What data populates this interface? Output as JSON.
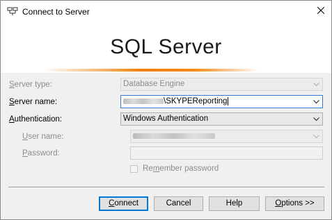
{
  "window": {
    "title": "Connect to Server",
    "icon": "server-connect-icon"
  },
  "banner": {
    "product": "SQL Server",
    "accent_color": "#f0800a"
  },
  "form": {
    "server_type": {
      "label": "Server type:",
      "value": "Database Engine",
      "enabled": false
    },
    "server_name": {
      "label": "Server name:",
      "value_suffix": "\\SKYPEReporting",
      "redacted_prefix": true,
      "focused": true
    },
    "authentication": {
      "label": "Authentication:",
      "value": "Windows Authentication"
    },
    "user_name": {
      "label": "User name:",
      "redacted": true,
      "enabled": false
    },
    "password": {
      "label": "Password:",
      "value": "",
      "enabled": false
    },
    "remember_password": {
      "label": "Remember password",
      "checked": false,
      "enabled": false
    }
  },
  "buttons": {
    "connect": "Connect",
    "cancel": "Cancel",
    "help": "Help",
    "options": "Options >>"
  },
  "colors": {
    "focus_border": "#2f79d2",
    "default_button_border": "#0078d7"
  }
}
